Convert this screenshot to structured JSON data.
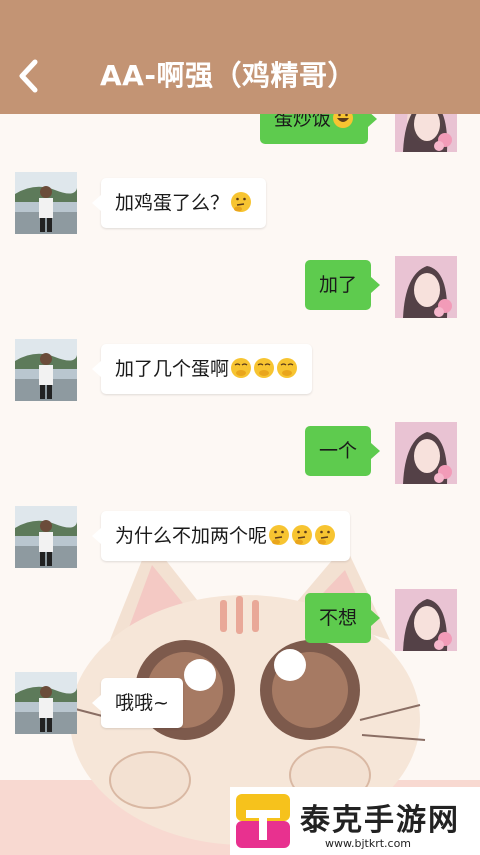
{
  "header": {
    "title": "AA-啊强（鸡精哥）",
    "back_icon": "chevron-left-icon",
    "background": "#c39474"
  },
  "messages": [
    {
      "side": "out",
      "text": "蛋炒饭",
      "emoji": [
        "grin"
      ]
    },
    {
      "side": "in",
      "text": "加鸡蛋了么？",
      "emoji": [
        "thinking"
      ]
    },
    {
      "side": "out",
      "text": "加了",
      "emoji": []
    },
    {
      "side": "in",
      "text": "加了几个蛋啊",
      "emoji": [
        "giggle",
        "giggle",
        "giggle"
      ]
    },
    {
      "side": "out",
      "text": "一个",
      "emoji": []
    },
    {
      "side": "in",
      "text": "为什么不加两个呢",
      "emoji": [
        "thinking",
        "thinking",
        "thinking"
      ]
    },
    {
      "side": "out",
      "text": "不想",
      "emoji": []
    },
    {
      "side": "in",
      "text": "哦哦~",
      "emoji": []
    }
  ],
  "colors": {
    "outgoing_bubble": "#5ecb4e",
    "incoming_bubble": "#ffffff",
    "chat_background": "#fdf8f4"
  },
  "watermark": {
    "name": "泰克手游网",
    "url": "www.bjtkrt.com"
  }
}
